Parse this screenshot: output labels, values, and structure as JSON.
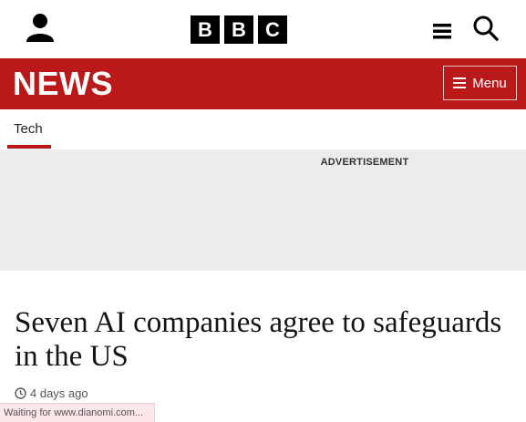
{
  "masthead": {
    "logo_letters": [
      "B",
      "B",
      "C"
    ],
    "account_icon": "user-icon",
    "more_icon": "hamburger-icon",
    "search_icon": "search-icon"
  },
  "news_bar": {
    "wordmark": "NEWS",
    "menu_label": "Menu",
    "background": "#bb1919"
  },
  "section_nav": {
    "active_tab": "Tech"
  },
  "advertisement": {
    "label": "ADVERTISEMENT"
  },
  "article": {
    "headline": "Seven AI companies agree to safeguards in the US",
    "timestamp": "4 days ago"
  },
  "status_bar": {
    "text": "Waiting for www.dianomi.com..."
  }
}
